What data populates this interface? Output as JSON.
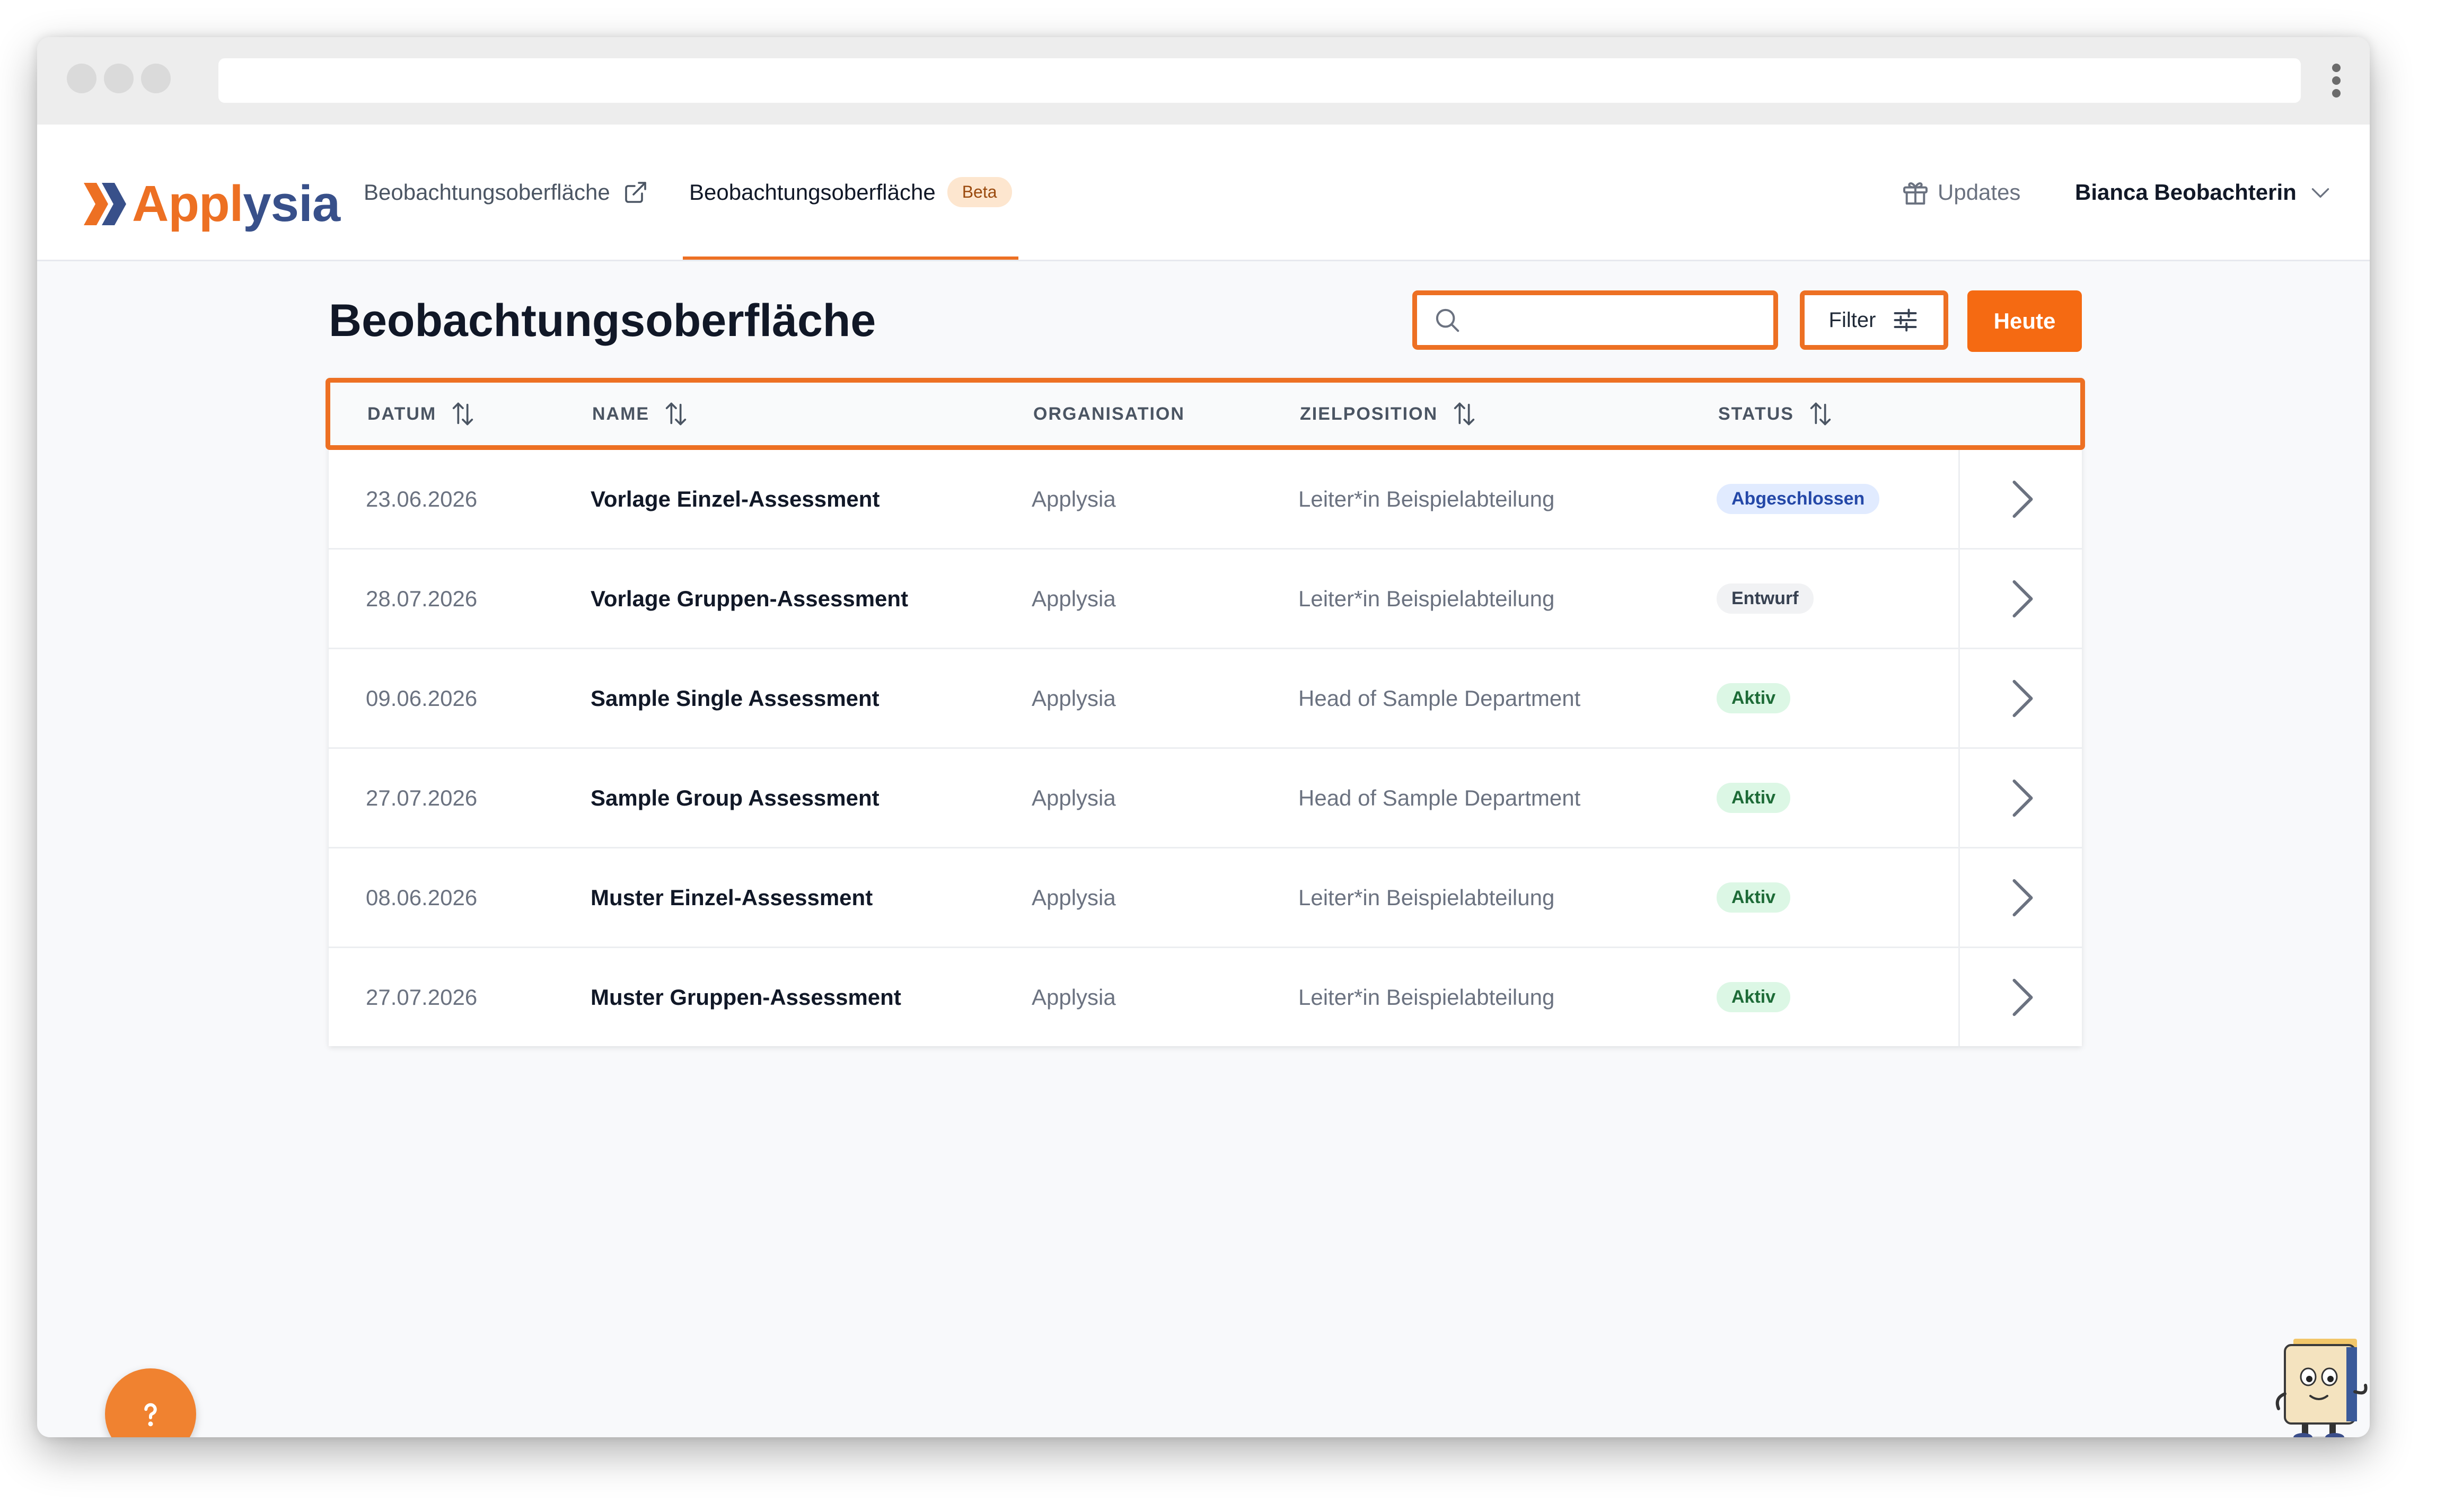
{
  "app": {
    "name_part1": "Appl",
    "name_part2": "ysia"
  },
  "nav": {
    "tab1_label": "Beobachtungsoberfläche",
    "tab2_label": "Beobachtungsoberfläche",
    "tab2_badge": "Beta",
    "updates_label": "Updates",
    "user_name": "Bianca Beobachterin"
  },
  "page": {
    "title": "Beobachtungsoberfläche",
    "search_placeholder": "",
    "filter_label": "Filter",
    "today_label": "Heute"
  },
  "table": {
    "headers": {
      "datum": "DATUM",
      "name": "NAME",
      "organisation": "ORGANISATION",
      "zielposition": "ZIELPOSITION",
      "status": "STATUS"
    },
    "rows": [
      {
        "datum": "23.06.2026",
        "name": "Vorlage Einzel-Assessment",
        "organisation": "Applysia",
        "zielposition": "Leiter*in Beispielabteilung",
        "status": "Abgeschlossen"
      },
      {
        "datum": "28.07.2026",
        "name": "Vorlage Gruppen-Assessment",
        "organisation": "Applysia",
        "zielposition": "Leiter*in Beispielabteilung",
        "status": "Entwurf"
      },
      {
        "datum": "09.06.2026",
        "name": "Sample Single Assessment",
        "organisation": "Applysia",
        "zielposition": "Head of Sample Department",
        "status": "Aktiv"
      },
      {
        "datum": "27.07.2026",
        "name": "Sample Group Assessment",
        "organisation": "Applysia",
        "zielposition": "Head of Sample Department",
        "status": "Aktiv"
      },
      {
        "datum": "08.06.2026",
        "name": "Muster Einzel-Assessment",
        "organisation": "Applysia",
        "zielposition": "Leiter*in Beispielabteilung",
        "status": "Aktiv"
      },
      {
        "datum": "27.07.2026",
        "name": "Muster Gruppen-Assessment",
        "organisation": "Applysia",
        "zielposition": "Leiter*in Beispielabteilung",
        "status": "Aktiv"
      }
    ]
  },
  "colors": {
    "accent": "#ed7023",
    "logo_blue": "#38508a",
    "status_done": "#e1ebff",
    "status_draft": "#f1f2f4",
    "status_active": "#dcf7e5"
  },
  "icons": [
    "external-link-icon",
    "gift-icon",
    "chevron-down-icon",
    "search-icon",
    "sliders-icon",
    "sort-icon",
    "chevron-right-icon",
    "question-icon",
    "mascot-icon"
  ]
}
